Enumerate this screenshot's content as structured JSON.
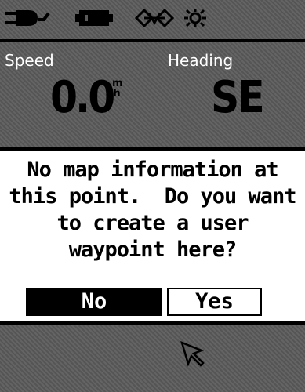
{
  "status_bar": {
    "icons": [
      "power-plug-icon",
      "battery-icon",
      "satellite-signal-icon",
      "backlight-sun-icon"
    ]
  },
  "data_fields": {
    "speed": {
      "label": "Speed",
      "value": "0.0",
      "unit_top": "m",
      "unit_bottom": "h"
    },
    "heading": {
      "label": "Heading",
      "value": "SE"
    }
  },
  "dialog": {
    "lines": [
      "No map information at",
      "this point.  Do you want",
      "to create a user",
      "waypoint here?"
    ],
    "buttons": {
      "no": "No",
      "yes": "Yes"
    },
    "selected": "no"
  },
  "colors": {
    "panel": "#5a5a5a",
    "dialog_bg": "#ffffff",
    "text_dark": "#000000",
    "text_light": "#ffffff"
  },
  "map_cursor": {
    "icon": "arrow-pointer-icon"
  }
}
